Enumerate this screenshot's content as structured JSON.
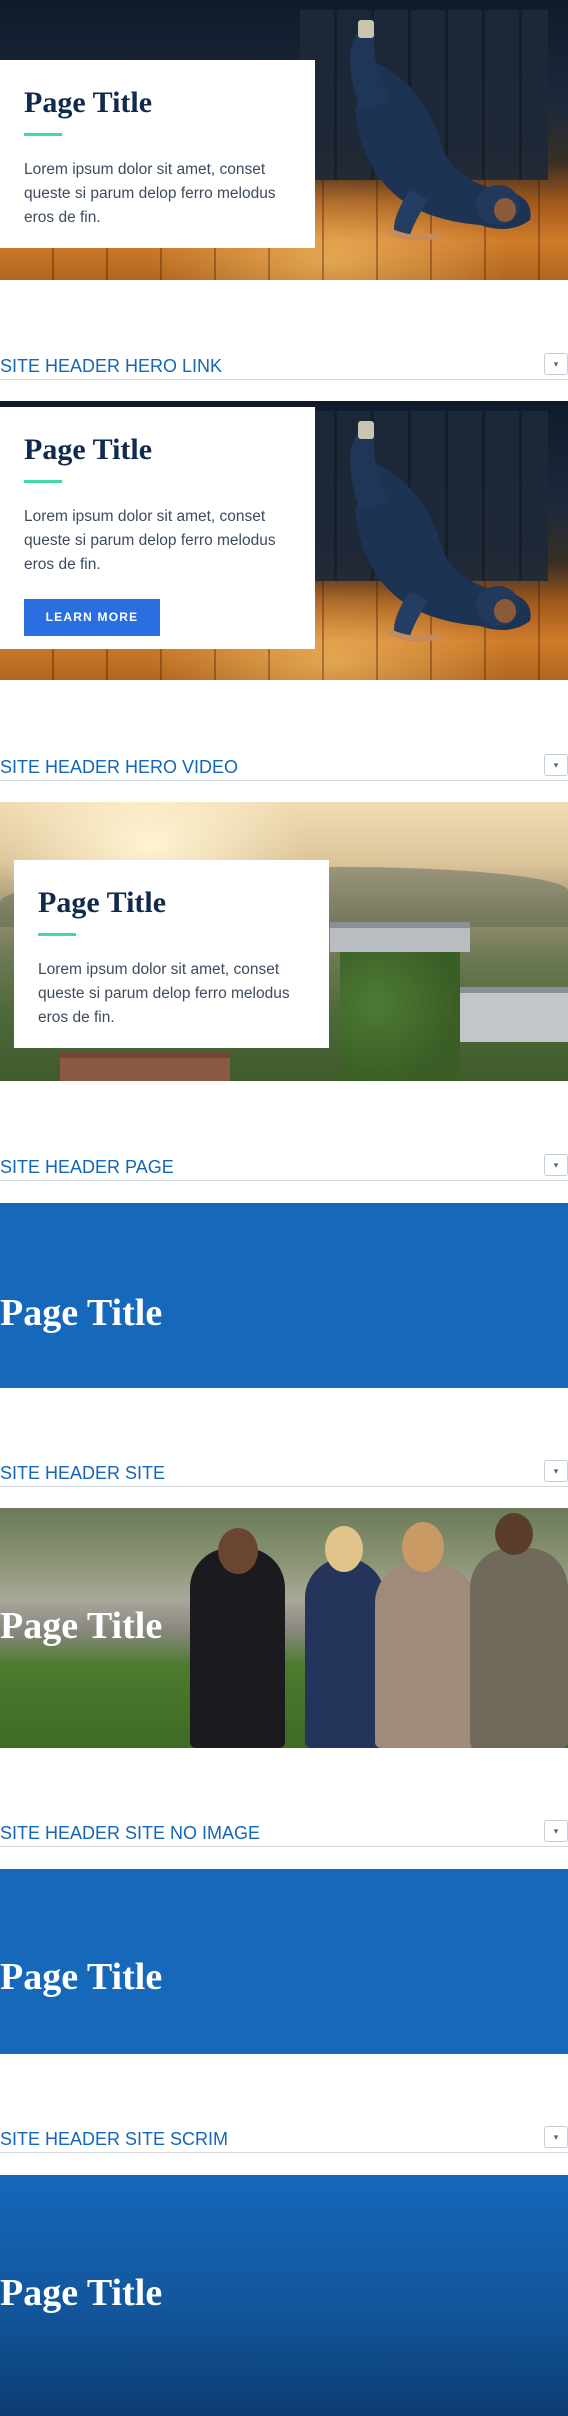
{
  "hero_card": {
    "title": "Page Title",
    "text": "Lorem ipsum dolor sit amet, conset queste si parum delop ferro melodus eros de fin.",
    "button_label": "LEARN MORE"
  },
  "sections": {
    "hero_link": {
      "label": "SITE HEADER HERO LINK"
    },
    "hero_video": {
      "label": "SITE HEADER HERO VIDEO"
    },
    "page": {
      "label": "SITE HEADER PAGE"
    },
    "site": {
      "label": "SITE HEADER SITE"
    },
    "site_no_image": {
      "label": "SITE HEADER SITE NO IMAGE"
    },
    "site_scrim": {
      "label": "SITE HEADER SITE SCRIM"
    }
  },
  "toggle_glyph": "▾",
  "band_title": "Page Title",
  "colors": {
    "brand_blue": "#1568ba",
    "button_blue": "#2a6ee0",
    "accent_green": "#3ed9a8",
    "heading_navy": "#0f2a4c"
  },
  "icons": [
    "chevron-down-icon"
  ]
}
